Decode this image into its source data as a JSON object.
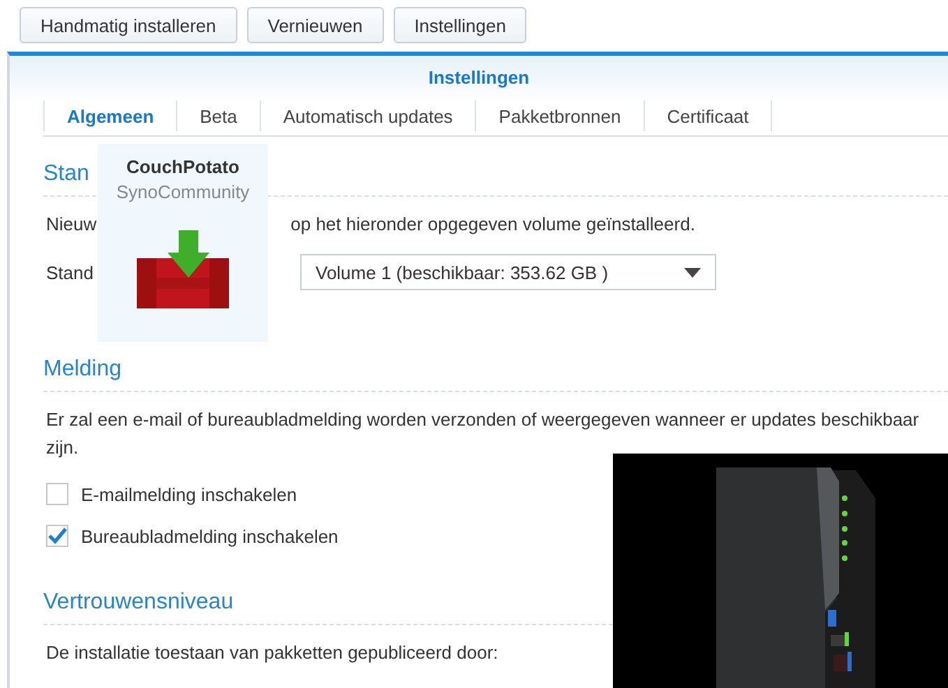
{
  "toolbar": {
    "buttons": [
      "Handmatig installeren",
      "Vernieuwen",
      "Instellingen"
    ]
  },
  "dialog": {
    "title": "Instellingen",
    "tabs": [
      {
        "label": "Algemeen",
        "selected": true
      },
      {
        "label": "Beta",
        "selected": false
      },
      {
        "label": "Automatisch updates",
        "selected": false
      },
      {
        "label": "Pakketbronnen",
        "selected": false
      },
      {
        "label": "Certificaat",
        "selected": false
      }
    ],
    "sections": [
      {
        "heading": "Stan",
        "items": [
          {
            "kind": "split-text",
            "left": "Nieuw",
            "right": "op het hieronder opgegeven volume geïnstalleerd."
          },
          {
            "kind": "select",
            "label": "Stand",
            "value": "Volume 1 (beschikbaar: 353.62 GB )"
          }
        ]
      },
      {
        "heading": "Melding",
        "items": [
          {
            "kind": "text",
            "text": "Er zal een e-mail of bureaubladmelding worden verzonden of weergegeven wanneer er updates beschikbaar zijn."
          },
          {
            "kind": "checkbox",
            "label": "E-mailmelding inschakelen",
            "checked": false
          },
          {
            "kind": "checkbox",
            "label": "Bureaubladmelding inschakelen",
            "checked": true
          }
        ]
      },
      {
        "heading": "Vertrouwensniveau",
        "items": [
          {
            "kind": "text",
            "text": "De installatie toestaan van pakketten gepubliceerd door:"
          }
        ]
      }
    ]
  },
  "package_card": {
    "name": "CouchPotato",
    "publisher": "SynoCommunity"
  }
}
